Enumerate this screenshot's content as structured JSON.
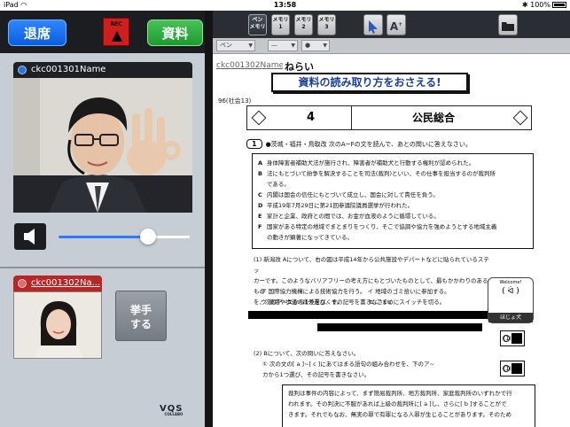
{
  "statusbar": {
    "device": "iPad",
    "wifi": "wifi",
    "time": "13:58",
    "bluetooth": "✱",
    "battery": "100%"
  },
  "left": {
    "exit_label": "退席",
    "rec_label": "REC",
    "material_label": "資料",
    "teacher_name": "ckc001301Name",
    "student_name": "ckc001302Na...",
    "raise_hand_label_1": "挙手",
    "raise_hand_label_2": "する",
    "volume_level": 0.68,
    "logo": "VQS",
    "logo_sub": "COLLABO"
  },
  "toolbar": {
    "tools": [
      {
        "line1": "ペン",
        "line2": "メモリ"
      },
      {
        "line1": "メモリ",
        "line2": "1"
      },
      {
        "line1": "メモリ",
        "line2": "2"
      },
      {
        "line1": "メモリ",
        "line2": "3"
      }
    ],
    "pen_select": "ペン",
    "line_select": "—",
    "color_select": "●"
  },
  "doc": {
    "user_label": "ckc001302Name",
    "aim_label": "ねらい",
    "aim_text": "資料の読み取り方をおさえる!",
    "page_number": "96(社会13)",
    "unit_number": "4",
    "unit_title": "公民総合",
    "q1_num": "1",
    "q1_text": "●茨城・福井・鳥取改 次のA~Fの文を読んで、あとの問いに答えなさい。",
    "statements": [
      {
        "key": "A",
        "text": "身体障害者補助犬法が施行され、障害者が補助犬と行動する権利が認められた。"
      },
      {
        "key": "B",
        "text": "法にもとづいて紛争を解決することを司法(裁判)といい、その仕事を担当するのが裁判所"
      },
      {
        "key": "",
        "text": "である。"
      },
      {
        "key": "C",
        "text": "内閣は国会の信任にもとづいて成立し、国会に対して責任を負う。"
      },
      {
        "key": "D",
        "text": "平成19年7月29日に第21回参議院議員選挙が行われた。"
      },
      {
        "key": "E",
        "text": "家計と企業、政府との間では、お金が血液のように循環している。"
      },
      {
        "key": "F",
        "text": "国家がある特定の地域でまとまりをつくり、そこで協調や協力を強めようとする地域主義"
      },
      {
        "key": "",
        "text": "の動きが顕著になってきている。"
      }
    ],
    "q1_1_lines": [
      "(1) 新潟改 Aについて、右の図は平成14年から公共施設やデパートなどに貼られているステッ",
      "カーです。このようなバリアフリーの考え方にもとづいたものとして、最もかかわりのあるもの",
      "を、次のア~エから1つ選び、その記号を書きなさい。"
    ],
    "q1_1_opts": [
      "ア 国際協力機構による技術協力を行う。 イ 地域のゴミ拾いに参加する。",
      "ウ 道路や歩道の段差をなくす。　　　　　エ こまめにスイッチを切る。"
    ],
    "mascot_welcome": "Welcome!",
    "mascot_face": "( ᐛ )",
    "mascot_label": "ほじょ犬",
    "ans1": "(1)",
    "ans2": "(1)",
    "q2_text": "(2) Bについて、次の問いに答えなさい。",
    "q2_1_lines": [
      "① 次の文の[ a ]~[ c ]にあてはまる語句の組み合わせを、下のア~",
      "カから1つ選び、その記号を書きなさい。"
    ],
    "q2_box_lines": [
      "裁判は事件の内容によって、まず簡易裁判所、地方裁判所、家庭裁判所のいずれかで行",
      "われます。その判決に不服があれば上級の裁判所に[ a ]し、さらに[ b ]することがで",
      "きます。それでもなお、無実の罪で有罪になる人罪が生じることがあります。そのため"
    ]
  }
}
